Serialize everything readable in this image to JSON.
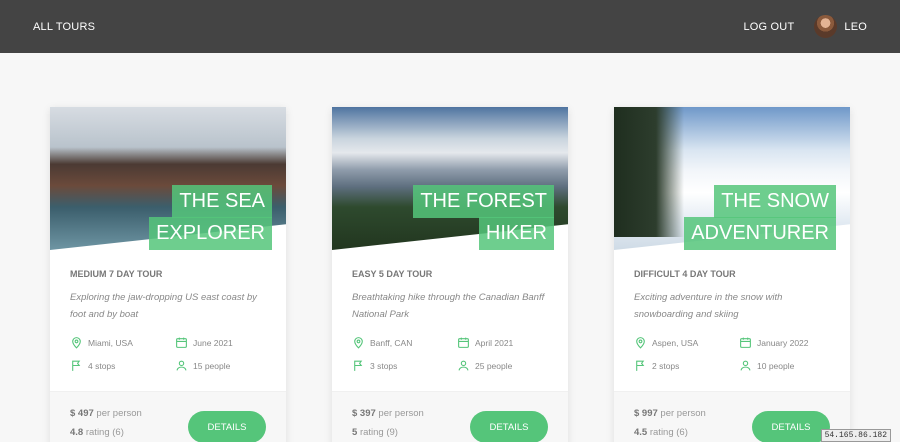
{
  "header": {
    "all_tours": "ALL TOURS",
    "logout": "LOG OUT",
    "user_name": "LEO"
  },
  "accent_color": "#55c57a",
  "tours": [
    {
      "title_line1": "THE SEA",
      "title_line2": "EXPLORER",
      "subheading": "MEDIUM 7 DAY TOUR",
      "summary": "Exploring the jaw-dropping US east coast by foot and by boat",
      "location": "Miami, USA",
      "date": "June 2021",
      "stops": "4 stops",
      "people": "15 people",
      "price": "$ 497",
      "price_suffix": "per person",
      "rating": "4.8",
      "rating_suffix": "rating (6)",
      "button": "DETAILS"
    },
    {
      "title_line1": "THE FOREST",
      "title_line2": "HIKER",
      "subheading": "EASY 5 DAY TOUR",
      "summary": "Breathtaking hike through the Canadian Banff National Park",
      "location": "Banff, CAN",
      "date": "April 2021",
      "stops": "3 stops",
      "people": "25 people",
      "price": "$ 397",
      "price_suffix": "per person",
      "rating": "5",
      "rating_suffix": "rating (9)",
      "button": "DETAILS"
    },
    {
      "title_line1": "THE SNOW",
      "title_line2": "ADVENTURER",
      "subheading": "DIFFICULT 4 DAY TOUR",
      "summary": "Exciting adventure in the snow with snowboarding and skiing",
      "location": "Aspen, USA",
      "date": "January 2022",
      "stops": "2 stops",
      "people": "10 people",
      "price": "$ 997",
      "price_suffix": "per person",
      "rating": "4.5",
      "rating_suffix": "rating (6)",
      "button": "DETAILS"
    }
  ],
  "ip_badge": "54.165.86.182"
}
